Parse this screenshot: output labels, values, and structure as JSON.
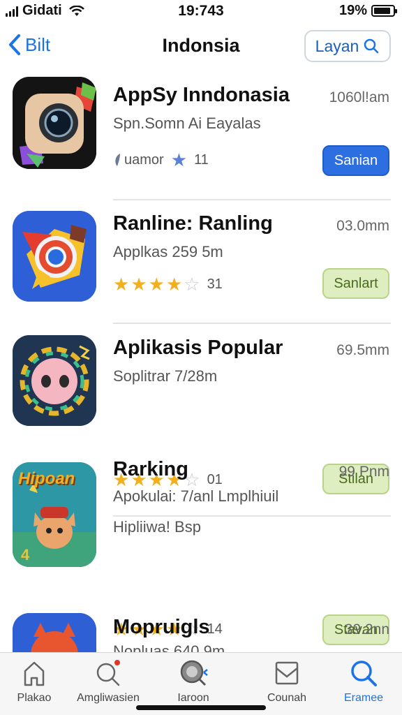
{
  "status_bar": {
    "carrier": "Gidati",
    "time": "19:743",
    "battery_percent": "19%",
    "battery_level": 0.9
  },
  "nav": {
    "back_label": "Bilt",
    "title": "Indonsia",
    "search_label": "Layan"
  },
  "apps": [
    {
      "name": "AppSy Inndonasia",
      "size": "1060l!am",
      "subtitle": "Spn.Somn Ai Eayalas",
      "rating_text": "uamor",
      "rating_count": "11",
      "button_label": "Sanian",
      "button_style": "blue",
      "icon": "camera-app-icon"
    },
    {
      "name": "Ranline: Ranling",
      "size": "03.0mm",
      "subtitle": "Applkas 259 5m",
      "stars": 4,
      "rating_count": "31",
      "button_label": "Sanlart",
      "button_style": "green",
      "icon": "browser-app-icon"
    },
    {
      "name": "Aplikasis Popular",
      "size": "69.5mm",
      "subtitle": "Soplitrar 7/28m",
      "stars": 4,
      "rating_count": "01",
      "button_label": "Stilan",
      "button_style": "green",
      "icon": "pig-game-icon"
    },
    {
      "name": "Rarking",
      "size": "99 Pnm",
      "subtitle": "Apokulai: 7/anl Lmplhiuil",
      "subtitle2": "Hipliiwa! Bsp",
      "stars": 4,
      "rating_count": "14",
      "button_label": "Stavan",
      "button_style": "green",
      "icon": "cartoon-game-icon",
      "icon_text": "Hipoan"
    },
    {
      "name": "Mopruigls",
      "size": "39.2nn",
      "subtitle": "Nopluas 640 9m",
      "icon": "fox-app-icon"
    }
  ],
  "tabs": [
    {
      "label": "Plakao",
      "icon": "home-icon"
    },
    {
      "label": "Amgliwasien",
      "icon": "search-notification-icon"
    },
    {
      "label": "Iaroon",
      "icon": "discover-icon"
    },
    {
      "label": "Counah",
      "icon": "inbox-icon"
    },
    {
      "label": "Eramee",
      "icon": "search-icon",
      "active": true
    }
  ],
  "colors": {
    "accent": "#1a73e8",
    "star": "#f2b01e",
    "install_blue": "#2d6fe0",
    "install_green": "#dfeec0"
  }
}
